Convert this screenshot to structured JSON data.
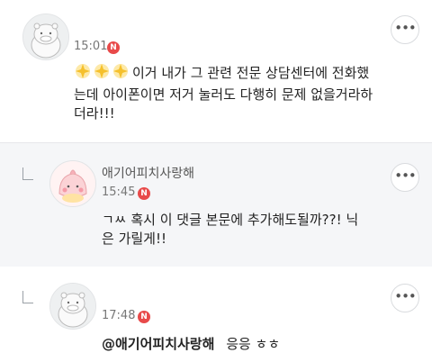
{
  "comments": [
    {
      "nickname": "",
      "time": "15:01",
      "new_badge": "N",
      "more_label": "•••",
      "line1": "이거 내가 그 관련 전문 상담센터에 전화했",
      "line2": "는데 아이폰이면 저거 눌러도 다행히 문제 없을거라하",
      "line3": "더라!!!",
      "emoji_icon": "sparkle-star-icon",
      "emoji_count": 3
    },
    {
      "nickname": "애기어피치사랑해",
      "time": "15:45",
      "new_badge": "N",
      "more_label": "•••",
      "line1": "ㄱㅆ 혹시 이 댓글 본문에 추가해도될까??! 닉",
      "line2": "은 가릴게!!"
    },
    {
      "nickname": "",
      "time": "17:48",
      "new_badge": "N",
      "more_label": "•••",
      "mention": "@애기어피치사랑해",
      "text": "응응 ㅎㅎ"
    }
  ],
  "colors": {
    "badge": "#e84a4a",
    "reply_bg": "#f5f6f8",
    "text": "#222222",
    "meta": "#777777"
  }
}
